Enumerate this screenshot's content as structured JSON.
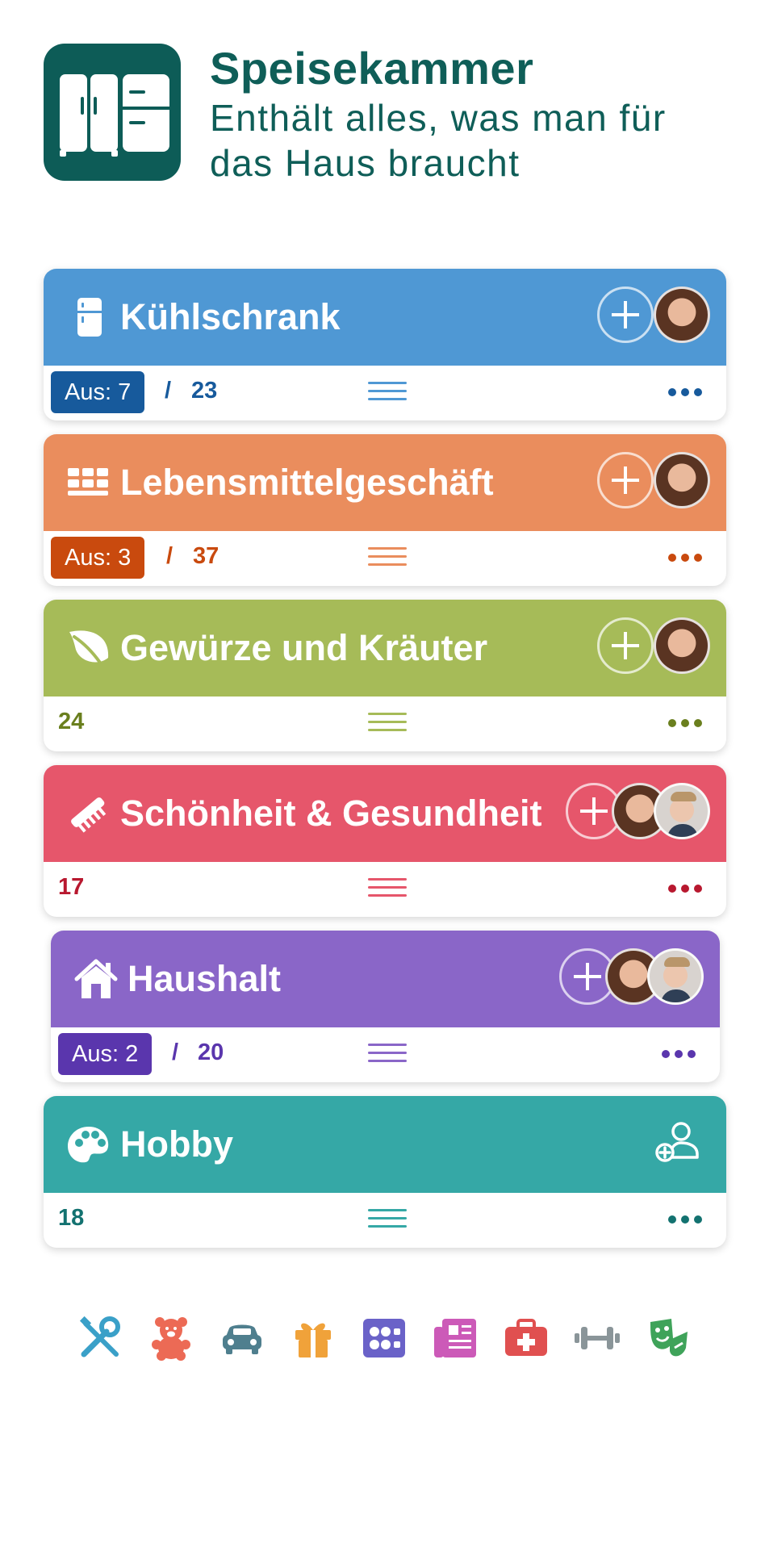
{
  "header": {
    "title": "Speisekammer",
    "subtitle": "Enthält alles, was man für das Haus braucht",
    "icon": "fridge-icon"
  },
  "colors": {
    "brand": "#0d5c57",
    "kuehlschrank": "#4f98d4",
    "lebensmittel": "#ea8d5d",
    "gewuerze": "#a6bb58",
    "schoenheit": "#e6566b",
    "haushalt": "#8a66c8",
    "hobby": "#35a8a6"
  },
  "categories": [
    {
      "name": "Kühlschrank",
      "icon": "fridge-icon",
      "out_label": "Aus: 7",
      "total": "23"
    },
    {
      "name": "Lebensmittelgeschäft",
      "icon": "grid-icon",
      "out_label": "Aus: 3",
      "total": "37"
    },
    {
      "name": "Gewürze und Kräuter",
      "icon": "leaf-icon",
      "total": "24"
    },
    {
      "name": "Schönheit & Gesundheit",
      "icon": "comb-icon",
      "total": "17"
    },
    {
      "name": "Haushalt",
      "icon": "house-icon",
      "out_label": "Aus: 2",
      "total": "20"
    },
    {
      "name": "Hobby",
      "icon": "palette-icon",
      "total": "18"
    }
  ],
  "slash": "/",
  "bottom_icons": [
    "tools-icon",
    "teddy-bear-icon",
    "car-icon",
    "gift-icon",
    "stove-icon",
    "newspaper-icon",
    "first-aid-icon",
    "dumbbell-icon",
    "theater-masks-icon"
  ]
}
